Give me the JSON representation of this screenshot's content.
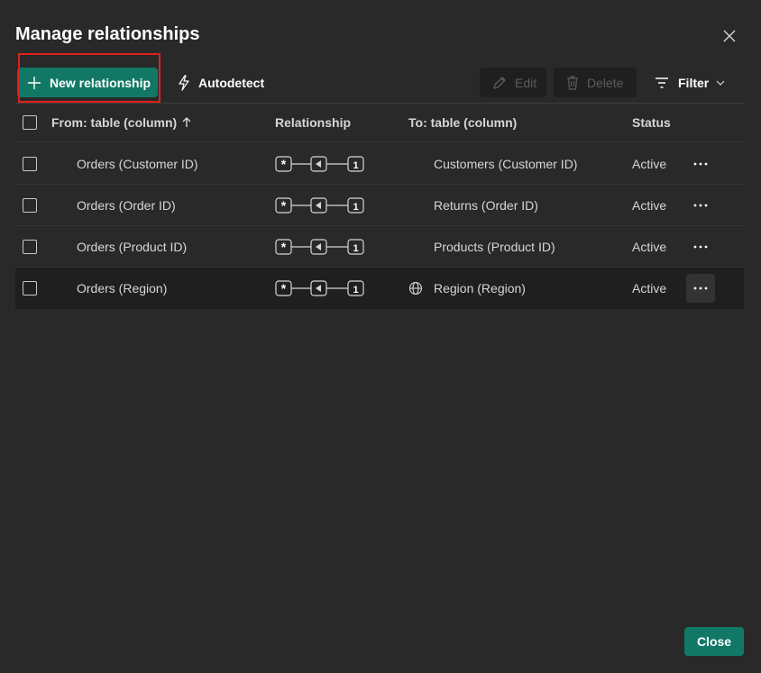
{
  "dialog": {
    "title": "Manage relationships",
    "close_icon": "close-icon"
  },
  "toolbar": {
    "new_label": "New relationship",
    "autodetect_label": "Autodetect",
    "edit_label": "Edit",
    "delete_label": "Delete",
    "filter_label": "Filter"
  },
  "table": {
    "headers": {
      "from": "From: table (column)",
      "relationship": "Relationship",
      "to": "To: table (column)",
      "status": "Status"
    },
    "sort_indicator": "ascending",
    "rows": [
      {
        "from": "Orders (Customer ID)",
        "to": "Customers (Customer ID)",
        "status": "Active",
        "cardinality_from": "*",
        "cardinality_to": "1",
        "globe": false,
        "selected": false
      },
      {
        "from": "Orders (Order ID)",
        "to": "Returns (Order ID)",
        "status": "Active",
        "cardinality_from": "*",
        "cardinality_to": "1",
        "globe": false,
        "selected": false
      },
      {
        "from": "Orders (Product ID)",
        "to": "Products (Product ID)",
        "status": "Active",
        "cardinality_from": "*",
        "cardinality_to": "1",
        "globe": false,
        "selected": false
      },
      {
        "from": "Orders (Region)",
        "to": "Region (Region)",
        "status": "Active",
        "cardinality_from": "*",
        "cardinality_to": "1",
        "globe": true,
        "selected": true
      }
    ]
  },
  "footer": {
    "close_label": "Close"
  },
  "colors": {
    "background": "#292929",
    "accent": "#117865",
    "highlight": "#e0201e",
    "selected_row": "#1f1f1f"
  }
}
